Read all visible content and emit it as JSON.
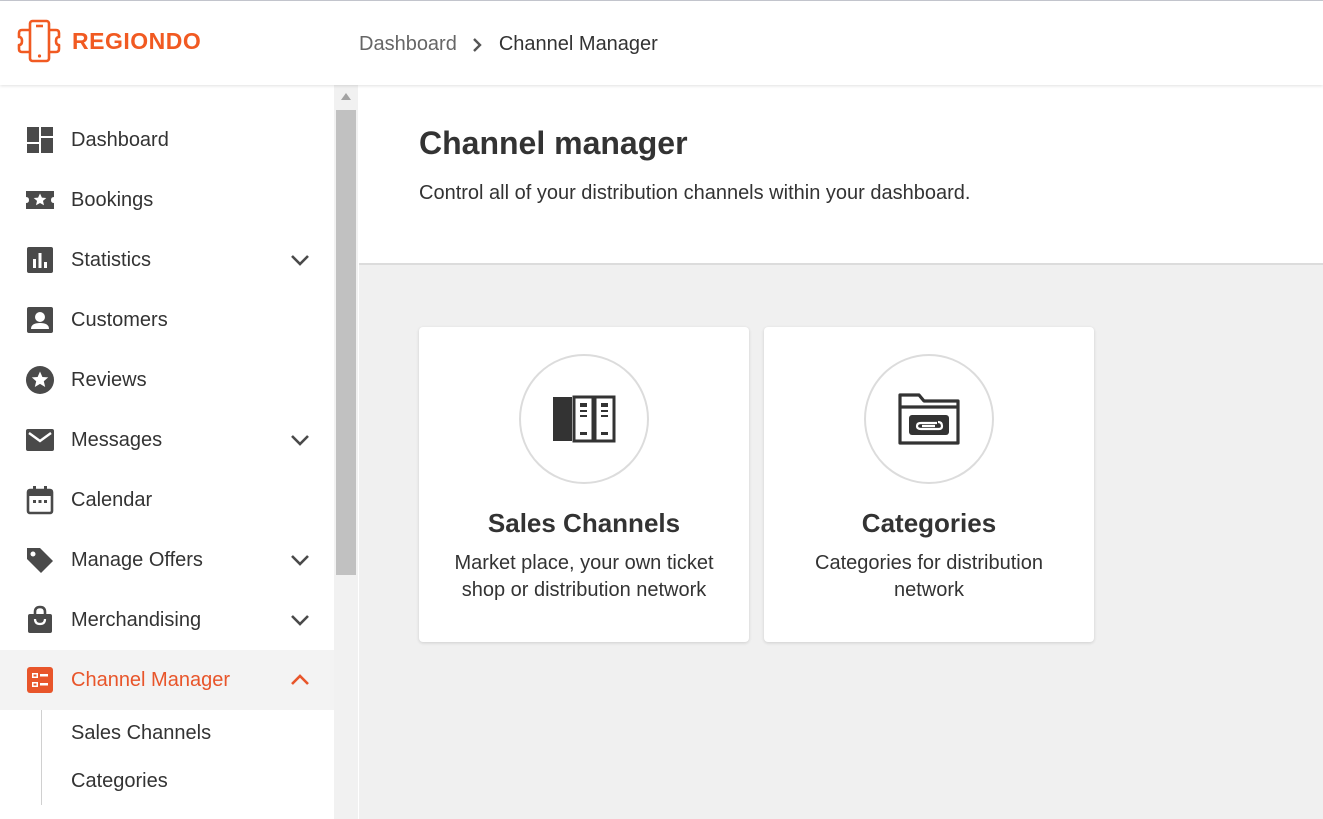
{
  "brand": {
    "name": "REGIONDO",
    "accent": "#f15a22",
    "active_color": "#e8552a"
  },
  "breadcrumb": {
    "home": "Dashboard",
    "current": "Channel Manager"
  },
  "sidebar": {
    "items": [
      {
        "label": "Dashboard",
        "icon": "dashboard-icon",
        "expandable": false
      },
      {
        "label": "Bookings",
        "icon": "ticket-star-icon",
        "expandable": false
      },
      {
        "label": "Statistics",
        "icon": "bar-chart-icon",
        "expandable": true
      },
      {
        "label": "Customers",
        "icon": "person-box-icon",
        "expandable": true
      },
      {
        "label": "Reviews",
        "icon": "star-circle-icon",
        "expandable": false
      },
      {
        "label": "Messages",
        "icon": "envelope-icon",
        "expandable": true
      },
      {
        "label": "Calendar",
        "icon": "calendar-icon",
        "expandable": false
      },
      {
        "label": "Manage Offers",
        "icon": "tag-icon",
        "expandable": true
      },
      {
        "label": "Merchandising",
        "icon": "shopping-bag-icon",
        "expandable": true
      },
      {
        "label": "Channel Manager",
        "icon": "channel-list-icon",
        "expandable": true,
        "active": true
      }
    ],
    "sub_items": [
      "Sales Channels",
      "Categories"
    ]
  },
  "main": {
    "title": "Channel manager",
    "description": "Control all of your distribution channels within your dashboard.",
    "cards": [
      {
        "title": "Sales Channels",
        "description": "Market place, your own ticket shop or distribution network",
        "icon": "binders-icon"
      },
      {
        "title": "Categories",
        "description": "Categories for distribution network",
        "icon": "folder-clip-icon"
      }
    ]
  }
}
